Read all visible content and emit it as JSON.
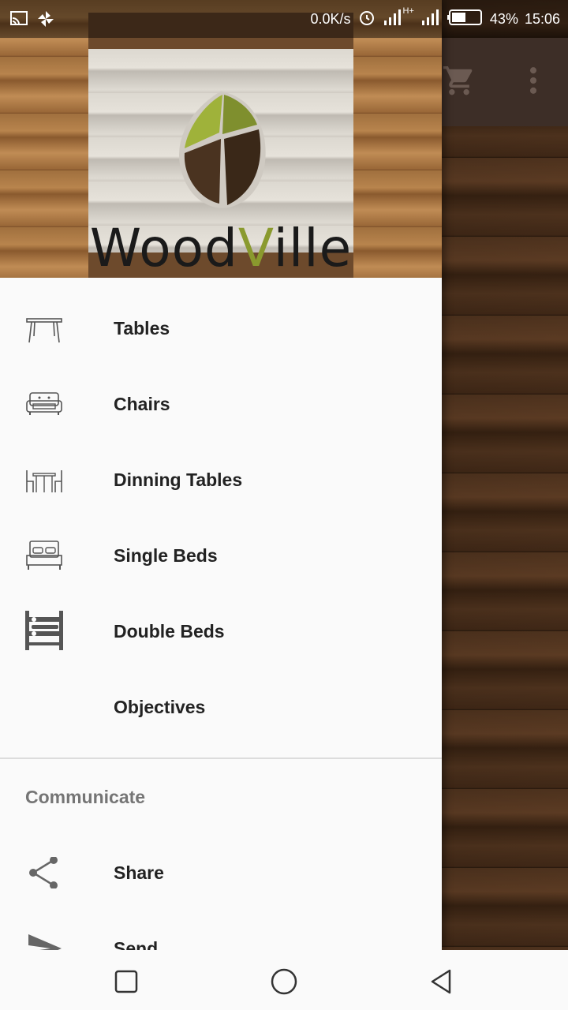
{
  "status_bar": {
    "speed": "0.0K/s",
    "network": "H+",
    "battery": "43%",
    "time": "15:06",
    "icons": [
      "screencast-icon",
      "pinwheel-icon",
      "alarm-icon",
      "signal-icon",
      "signal-icon",
      "battery-icon"
    ]
  },
  "toolbar": {
    "icons": [
      "cart-icon",
      "more-vert-icon"
    ]
  },
  "header": {
    "logo_text_a": "Wood",
    "logo_text_v": "V",
    "logo_text_b": "ille"
  },
  "menu": {
    "items": [
      {
        "label": "Tables",
        "icon": "table-icon"
      },
      {
        "label": "Chairs",
        "icon": "sofa-icon"
      },
      {
        "label": "Dinning Tables",
        "icon": "dining-table-icon"
      },
      {
        "label": "Single Beds",
        "icon": "bed-icon"
      },
      {
        "label": "Double Beds",
        "icon": "bunk-bed-icon"
      },
      {
        "label": "Objectives",
        "icon": ""
      }
    ],
    "section_title": "Communicate",
    "communicate": [
      {
        "label": "Share",
        "icon": "share-icon"
      },
      {
        "label": "Send",
        "icon": "send-icon"
      }
    ]
  },
  "nav_bar": {
    "icons": [
      "recents-icon",
      "home-icon",
      "back-icon"
    ]
  },
  "colors": {
    "drawer_bg": "#fafafa",
    "toolbar": "#3d2e27",
    "accent_leaf": "#8a9a2e"
  }
}
